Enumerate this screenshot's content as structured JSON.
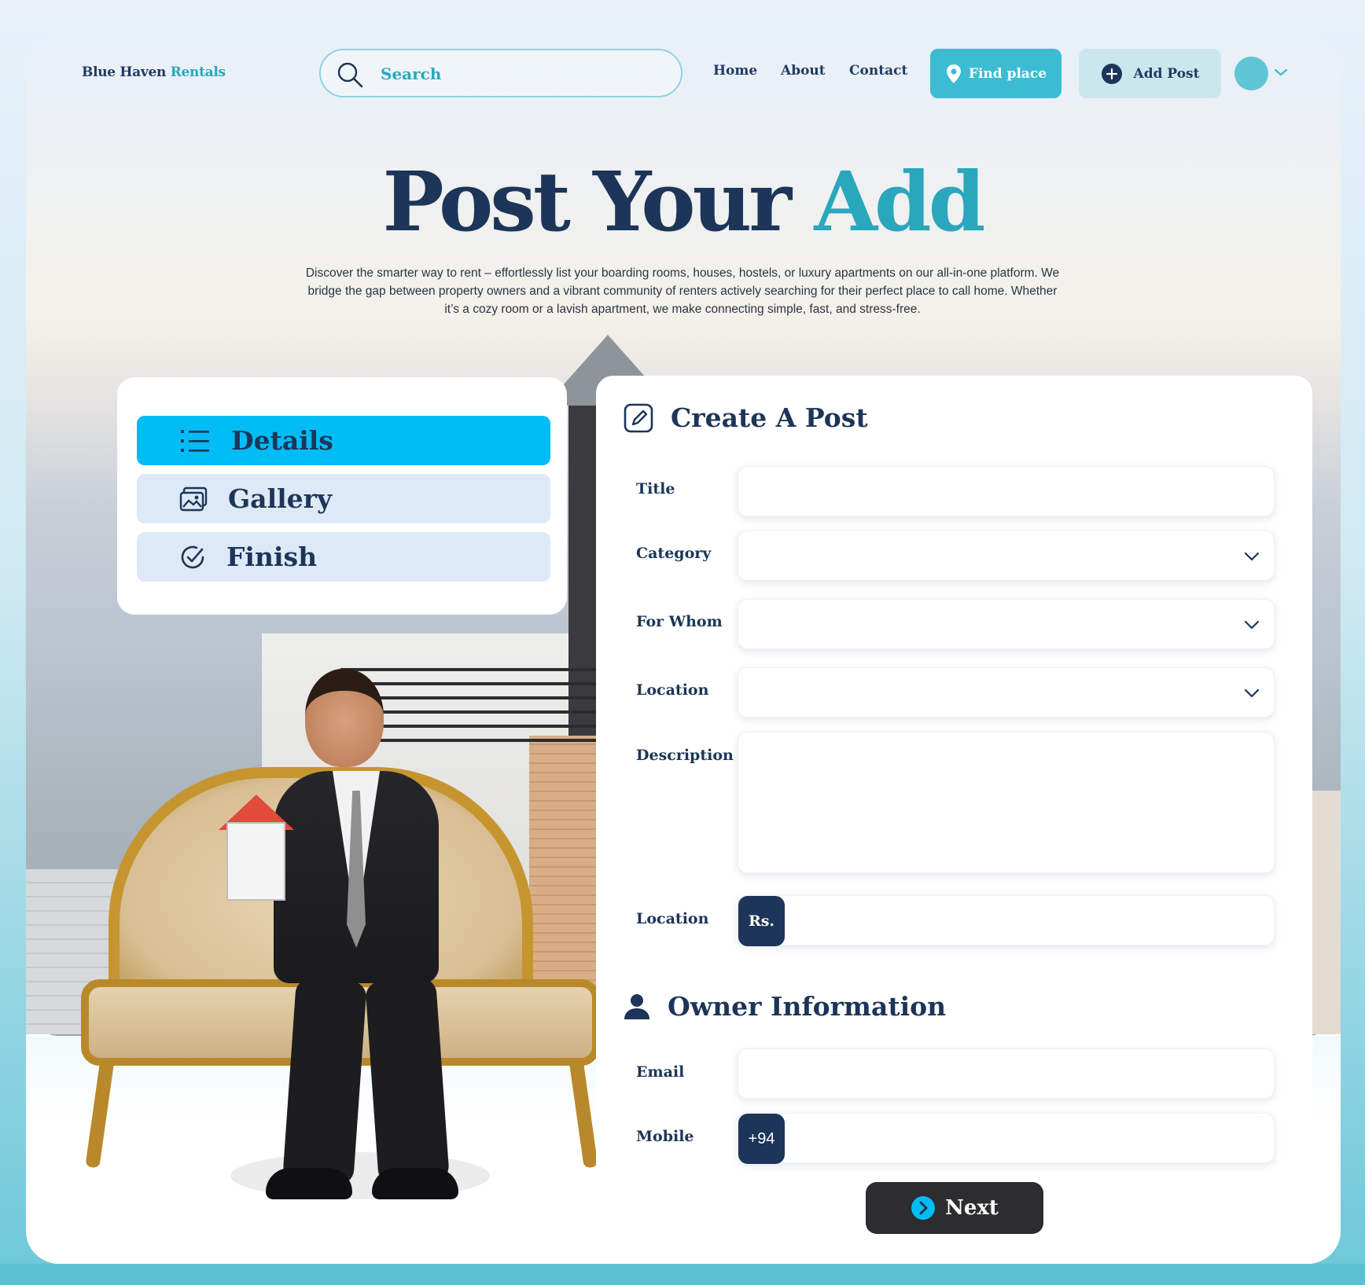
{
  "brand": {
    "name_part1": "Blue Haven",
    "name_part2": "Rentals"
  },
  "search": {
    "placeholder": "Search"
  },
  "nav": {
    "home": "Home",
    "about": "About",
    "contact": "Contact"
  },
  "buttons": {
    "find_place": "Find place",
    "add_post": "Add Post",
    "next": "Next"
  },
  "hero": {
    "title_part1": "Post Your",
    "title_part2": "Add",
    "description": "Discover the smarter way to rent – effortlessly list your boarding rooms, houses, hostels, or luxury apartments on our all-in-one platform. We bridge the gap between property owners and a vibrant community of renters actively searching for their perfect place to call home. Whether it’s a cozy room or a lavish apartment, we make connecting simple, fast, and stress-free."
  },
  "steps": [
    {
      "label": "Details",
      "icon": "list-icon",
      "active": true
    },
    {
      "label": "Gallery",
      "icon": "gallery-icon",
      "active": false
    },
    {
      "label": "Finish",
      "icon": "check-circle-icon",
      "active": false
    }
  ],
  "form": {
    "title": "Create A Post",
    "fields": {
      "title": {
        "label": "Title",
        "value": ""
      },
      "category": {
        "label": "Category",
        "value": ""
      },
      "for_whom": {
        "label": "For Whom",
        "value": ""
      },
      "location": {
        "label": "Location",
        "value": ""
      },
      "description": {
        "label": "Description",
        "value": ""
      },
      "price": {
        "label": "Location",
        "prefix": "Rs.",
        "value": ""
      }
    },
    "owner": {
      "title": "Owner Information",
      "email": {
        "label": "Email",
        "value": ""
      },
      "mobile": {
        "label": "Mobile",
        "prefix": "+94",
        "value": ""
      }
    }
  },
  "colors": {
    "navy": "#1c3558",
    "teal": "#2aa7bd",
    "active_step": "#00bcf5",
    "step_bg": "#dde9f6",
    "find_btn": "#3cbcd3",
    "add_btn": "#cbe7ee",
    "next_btn": "#2d2d2f"
  }
}
